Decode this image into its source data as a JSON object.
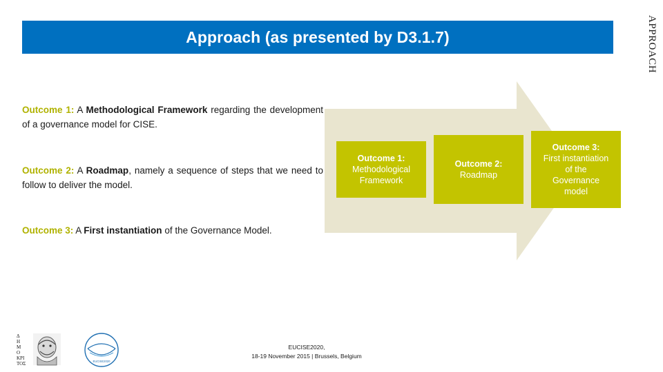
{
  "side_tab": {
    "label": "Approach"
  },
  "title": {
    "text": "Approach (as presented by D3.1.7)"
  },
  "paragraphs": [
    {
      "key": "Outcome 1:",
      "lead": " A ",
      "bold": "Methodological Framework",
      "rest": " regarding the development of a governance model for CISE."
    },
    {
      "key": "Outcome 2:",
      "lead": " A ",
      "bold": "Roadmap",
      "rest": ", namely a sequence of steps that we need to follow to deliver the model."
    },
    {
      "key": "Outcome 3:",
      "lead": " A ",
      "bold": "First instantiation",
      "rest": " of the Governance Model."
    }
  ],
  "outcome_boxes": [
    {
      "header": "Outcome 1:",
      "line1": "Methodological",
      "line2": "Framework",
      "line3": ""
    },
    {
      "header": "Outcome 2:",
      "line1": "Roadmap",
      "line2": "",
      "line3": ""
    },
    {
      "header": "Outcome 3:",
      "line1": "First instantiation",
      "line2": "of the",
      "line3": "Governance",
      "line4": "model"
    }
  ],
  "footer": {
    "line1": "EUCISE2020,",
    "line2": "18-19 November 2015 | Brussels, Belgium"
  },
  "logos": {
    "demokritos_text": "ΔΗΜΟΚΡΙΤΟΣ",
    "right_logo_text": "EUCISE2020"
  },
  "colors": {
    "title_bar": "#0070c0",
    "accent_olive": "#c3c400",
    "arrow_fill": "#e9e5cf",
    "text": "#1a1a1a"
  }
}
